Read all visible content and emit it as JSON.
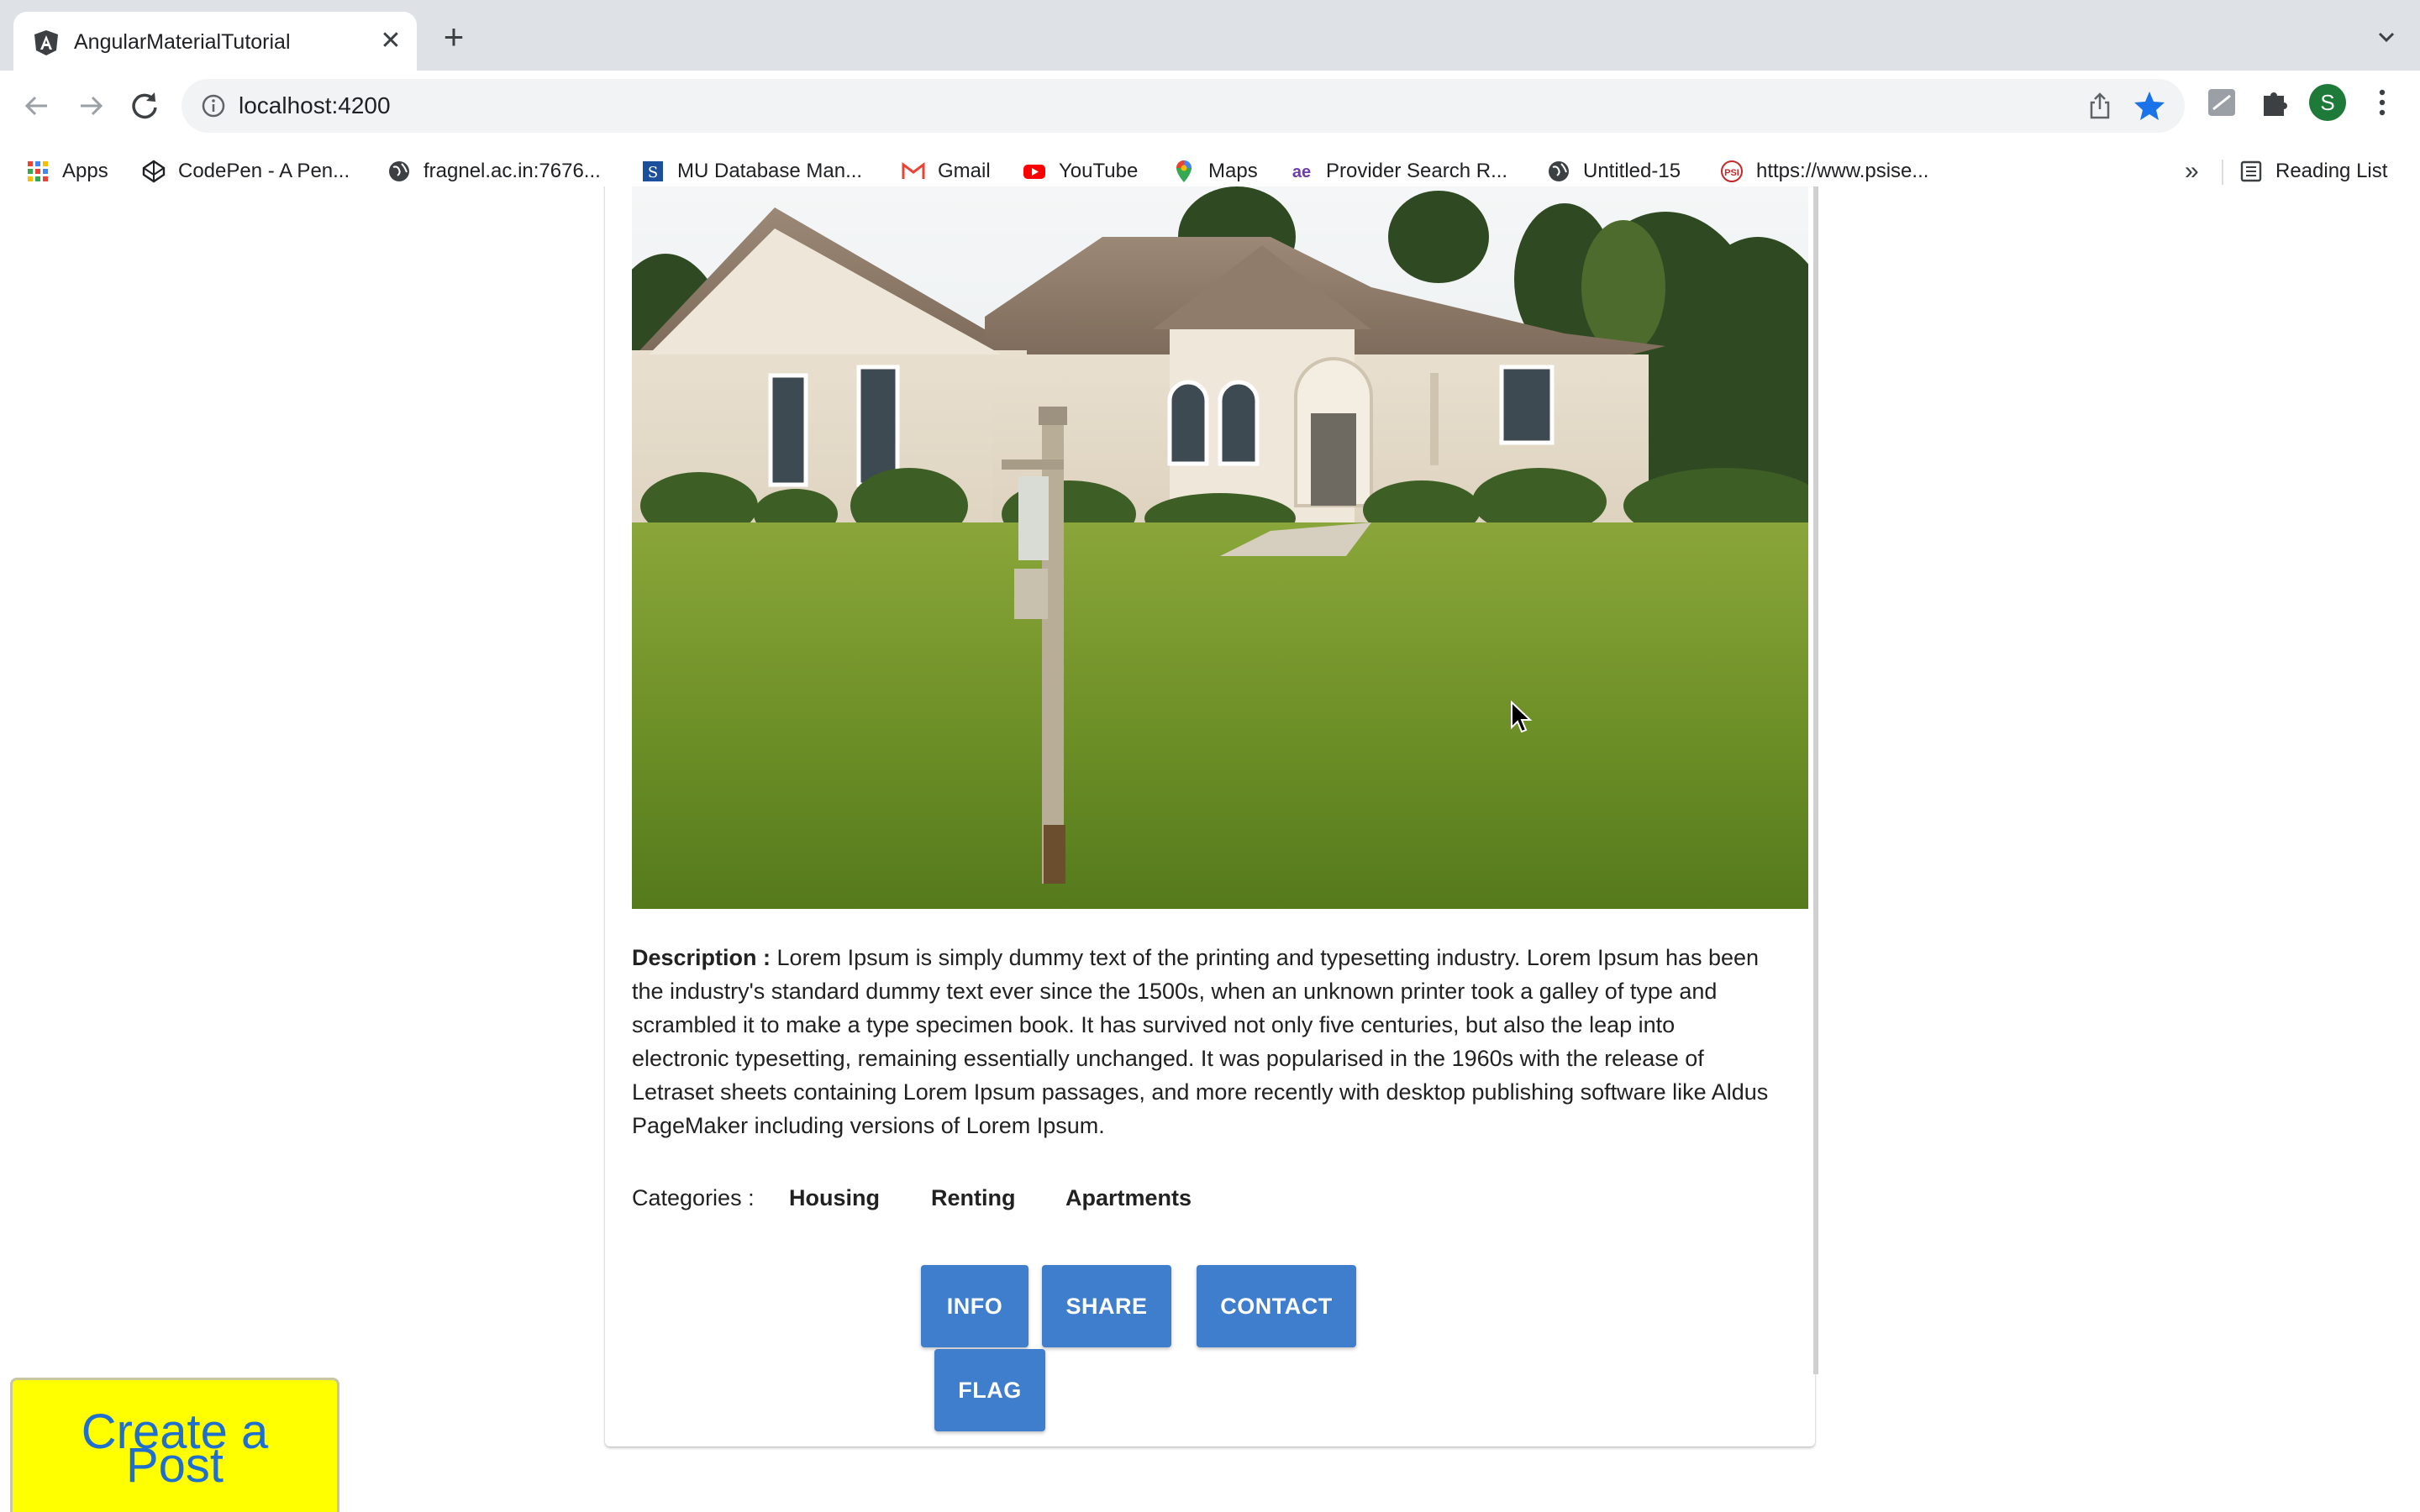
{
  "browser": {
    "tab": {
      "title": "AngularMaterialTutorial",
      "close": "✕"
    },
    "new_tab": "+",
    "address": {
      "url": "localhost:4200"
    },
    "profile_initial": "S",
    "bookmarks": [
      {
        "label": "Apps",
        "icon": "apps-grid-icon"
      },
      {
        "label": "CodePen - A Pen...",
        "icon": "codepen-icon"
      },
      {
        "label": "fragnel.ac.in:7676...",
        "icon": "globe-icon"
      },
      {
        "label": "MU Database Man...",
        "icon": "mu-database-icon"
      },
      {
        "label": "Gmail",
        "icon": "gmail-icon"
      },
      {
        "label": "YouTube",
        "icon": "youtube-icon"
      },
      {
        "label": "Maps",
        "icon": "maps-pin-icon"
      },
      {
        "label": "Provider Search R...",
        "icon": "ae-icon"
      },
      {
        "label": "Untitled-15",
        "icon": "globe-icon"
      },
      {
        "label": "https://www.psise...",
        "icon": "psi-icon"
      }
    ],
    "bookmarks_overflow": "»",
    "reading_list": "Reading List"
  },
  "post": {
    "image_alt": "House with lawn and for-sale sign post",
    "description_label": "Description :",
    "description_text": " Lorem Ipsum is simply dummy text of the printing and typesetting industry. Lorem Ipsum has been the industry's standard dummy text ever since the 1500s, when an unknown printer took a galley of type and scrambled it to make a type specimen book. It has survived not only five centuries, but also the leap into electronic typesetting, remaining essentially unchanged. It was popularised in the 1960s with the release of Letraset sheets containing Lorem Ipsum passages, and more recently with desktop publishing software like Aldus PageMaker including versions of Lorem Ipsum.",
    "categories_label": "Categories :",
    "categories": [
      "Housing",
      "Renting",
      "Apartments"
    ],
    "actions": {
      "info": "INFO",
      "share": "SHARE",
      "contact": "CONTACT",
      "flag": "FLAG"
    }
  },
  "create_post": {
    "line1": "Create a",
    "line2": "Post"
  },
  "colors": {
    "button": "#3f7dcd",
    "fab_bg": "#ffff00",
    "fab_text": "#1f6fd0"
  }
}
